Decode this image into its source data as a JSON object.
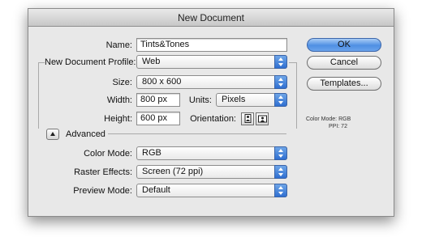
{
  "window": {
    "title": "New Document"
  },
  "fields": {
    "name_label": "Name:",
    "name_value": "Tints&Tones",
    "profile_label": "New Document Profile:",
    "profile_value": "Web",
    "size_label": "Size:",
    "size_value": "800 x 600",
    "width_label": "Width:",
    "width_value": "800 px",
    "units_label": "Units:",
    "units_value": "Pixels",
    "height_label": "Height:",
    "height_value": "600 px",
    "orientation_label": "Orientation:"
  },
  "advanced": {
    "label": "Advanced",
    "color_mode_label": "Color Mode:",
    "color_mode_value": "RGB",
    "raster_label": "Raster Effects:",
    "raster_value": "Screen (72 ppi)",
    "preview_label": "Preview Mode:",
    "preview_value": "Default"
  },
  "buttons": {
    "ok": "OK",
    "cancel": "Cancel",
    "templates": "Templates..."
  },
  "info": {
    "color_mode": "Color Mode: RGB",
    "ppi": "PPI: 72"
  },
  "icons": {
    "select": "dropdown-arrows-icon",
    "portrait": "portrait-orientation-icon",
    "landscape": "landscape-orientation-icon",
    "disclosure": "disclosure-triangle-icon"
  },
  "colors": {
    "accent": "#3a79d6",
    "dialog_bg": "#e8e8e8"
  }
}
